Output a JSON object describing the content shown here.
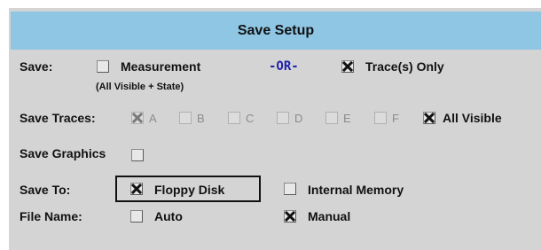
{
  "title": "Save Setup",
  "save": {
    "label": "Save:",
    "measurement_label": "Measurement",
    "measurement_note": "(All Visible + State)",
    "or_label": "-OR-",
    "traces_only_label": "Trace(s) Only"
  },
  "save_traces": {
    "label": "Save Traces:",
    "traces": [
      "A",
      "B",
      "C",
      "D",
      "E",
      "F"
    ],
    "all_visible_label": "All Visible"
  },
  "save_graphics": {
    "label": "Save Graphics"
  },
  "save_to": {
    "label": "Save To:",
    "floppy_label": "Floppy Disk",
    "internal_label": "Internal Memory"
  },
  "file_name": {
    "label": "File Name:",
    "auto_label": "Auto",
    "manual_label": "Manual"
  },
  "state": {
    "measurement": false,
    "traces_only": true,
    "trace_a": true,
    "trace_b": false,
    "trace_c": false,
    "trace_d": false,
    "trace_e": false,
    "trace_f": false,
    "all_visible": true,
    "save_graphics": false,
    "floppy_disk": true,
    "internal_memory": false,
    "auto": false,
    "manual": true
  },
  "colors": {
    "title_bar": "#8ec6e4",
    "panel": "#d4d4d4",
    "or_text": "#2222aa",
    "disabled_text": "#8c8c8c"
  }
}
